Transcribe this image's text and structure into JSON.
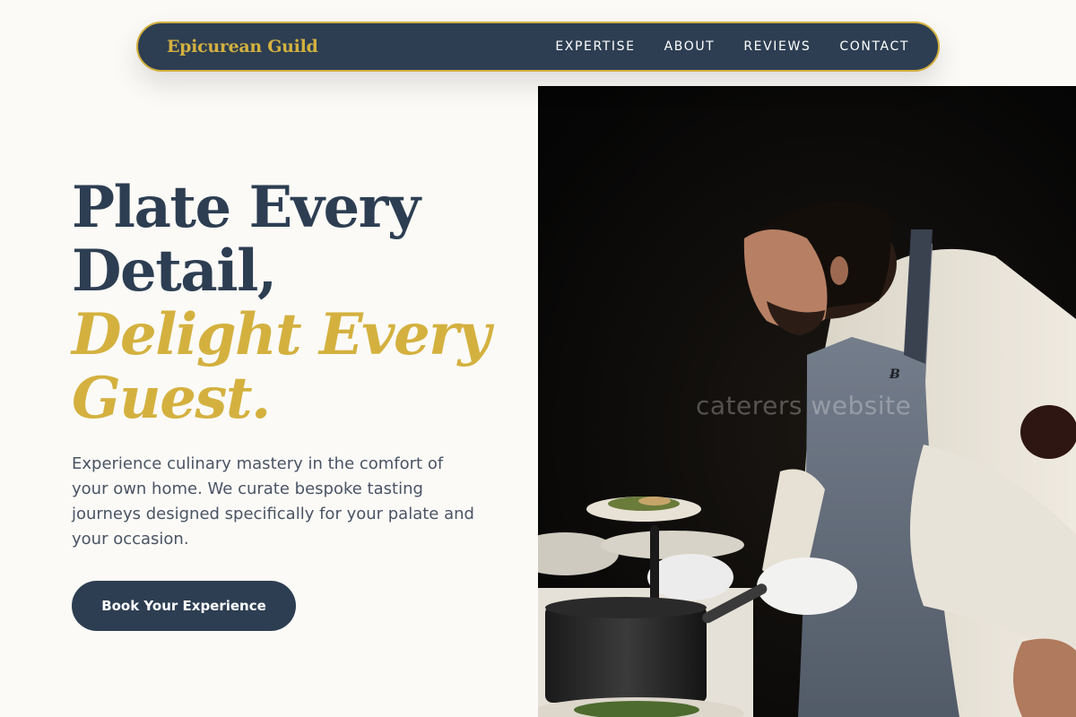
{
  "nav": {
    "brand": "Epicurean Guild",
    "links": [
      "EXPERTISE",
      "ABOUT",
      "REVIEWS",
      "CONTACT"
    ]
  },
  "hero": {
    "title_line1": "Plate Every",
    "title_line2": "Detail,",
    "title_accent_line1": "Delight Every",
    "title_accent_line2": "Guest.",
    "description": "Experience culinary mastery in the comfort of your own home. We curate bespoke tasting journeys designed specifically for your palate and your occasion.",
    "cta_label": "Book Your Experience"
  },
  "image": {
    "watermark": "caterers website"
  },
  "colors": {
    "navy": "#2d3e52",
    "gold": "#d4b13f",
    "background": "#fbfaf7"
  }
}
